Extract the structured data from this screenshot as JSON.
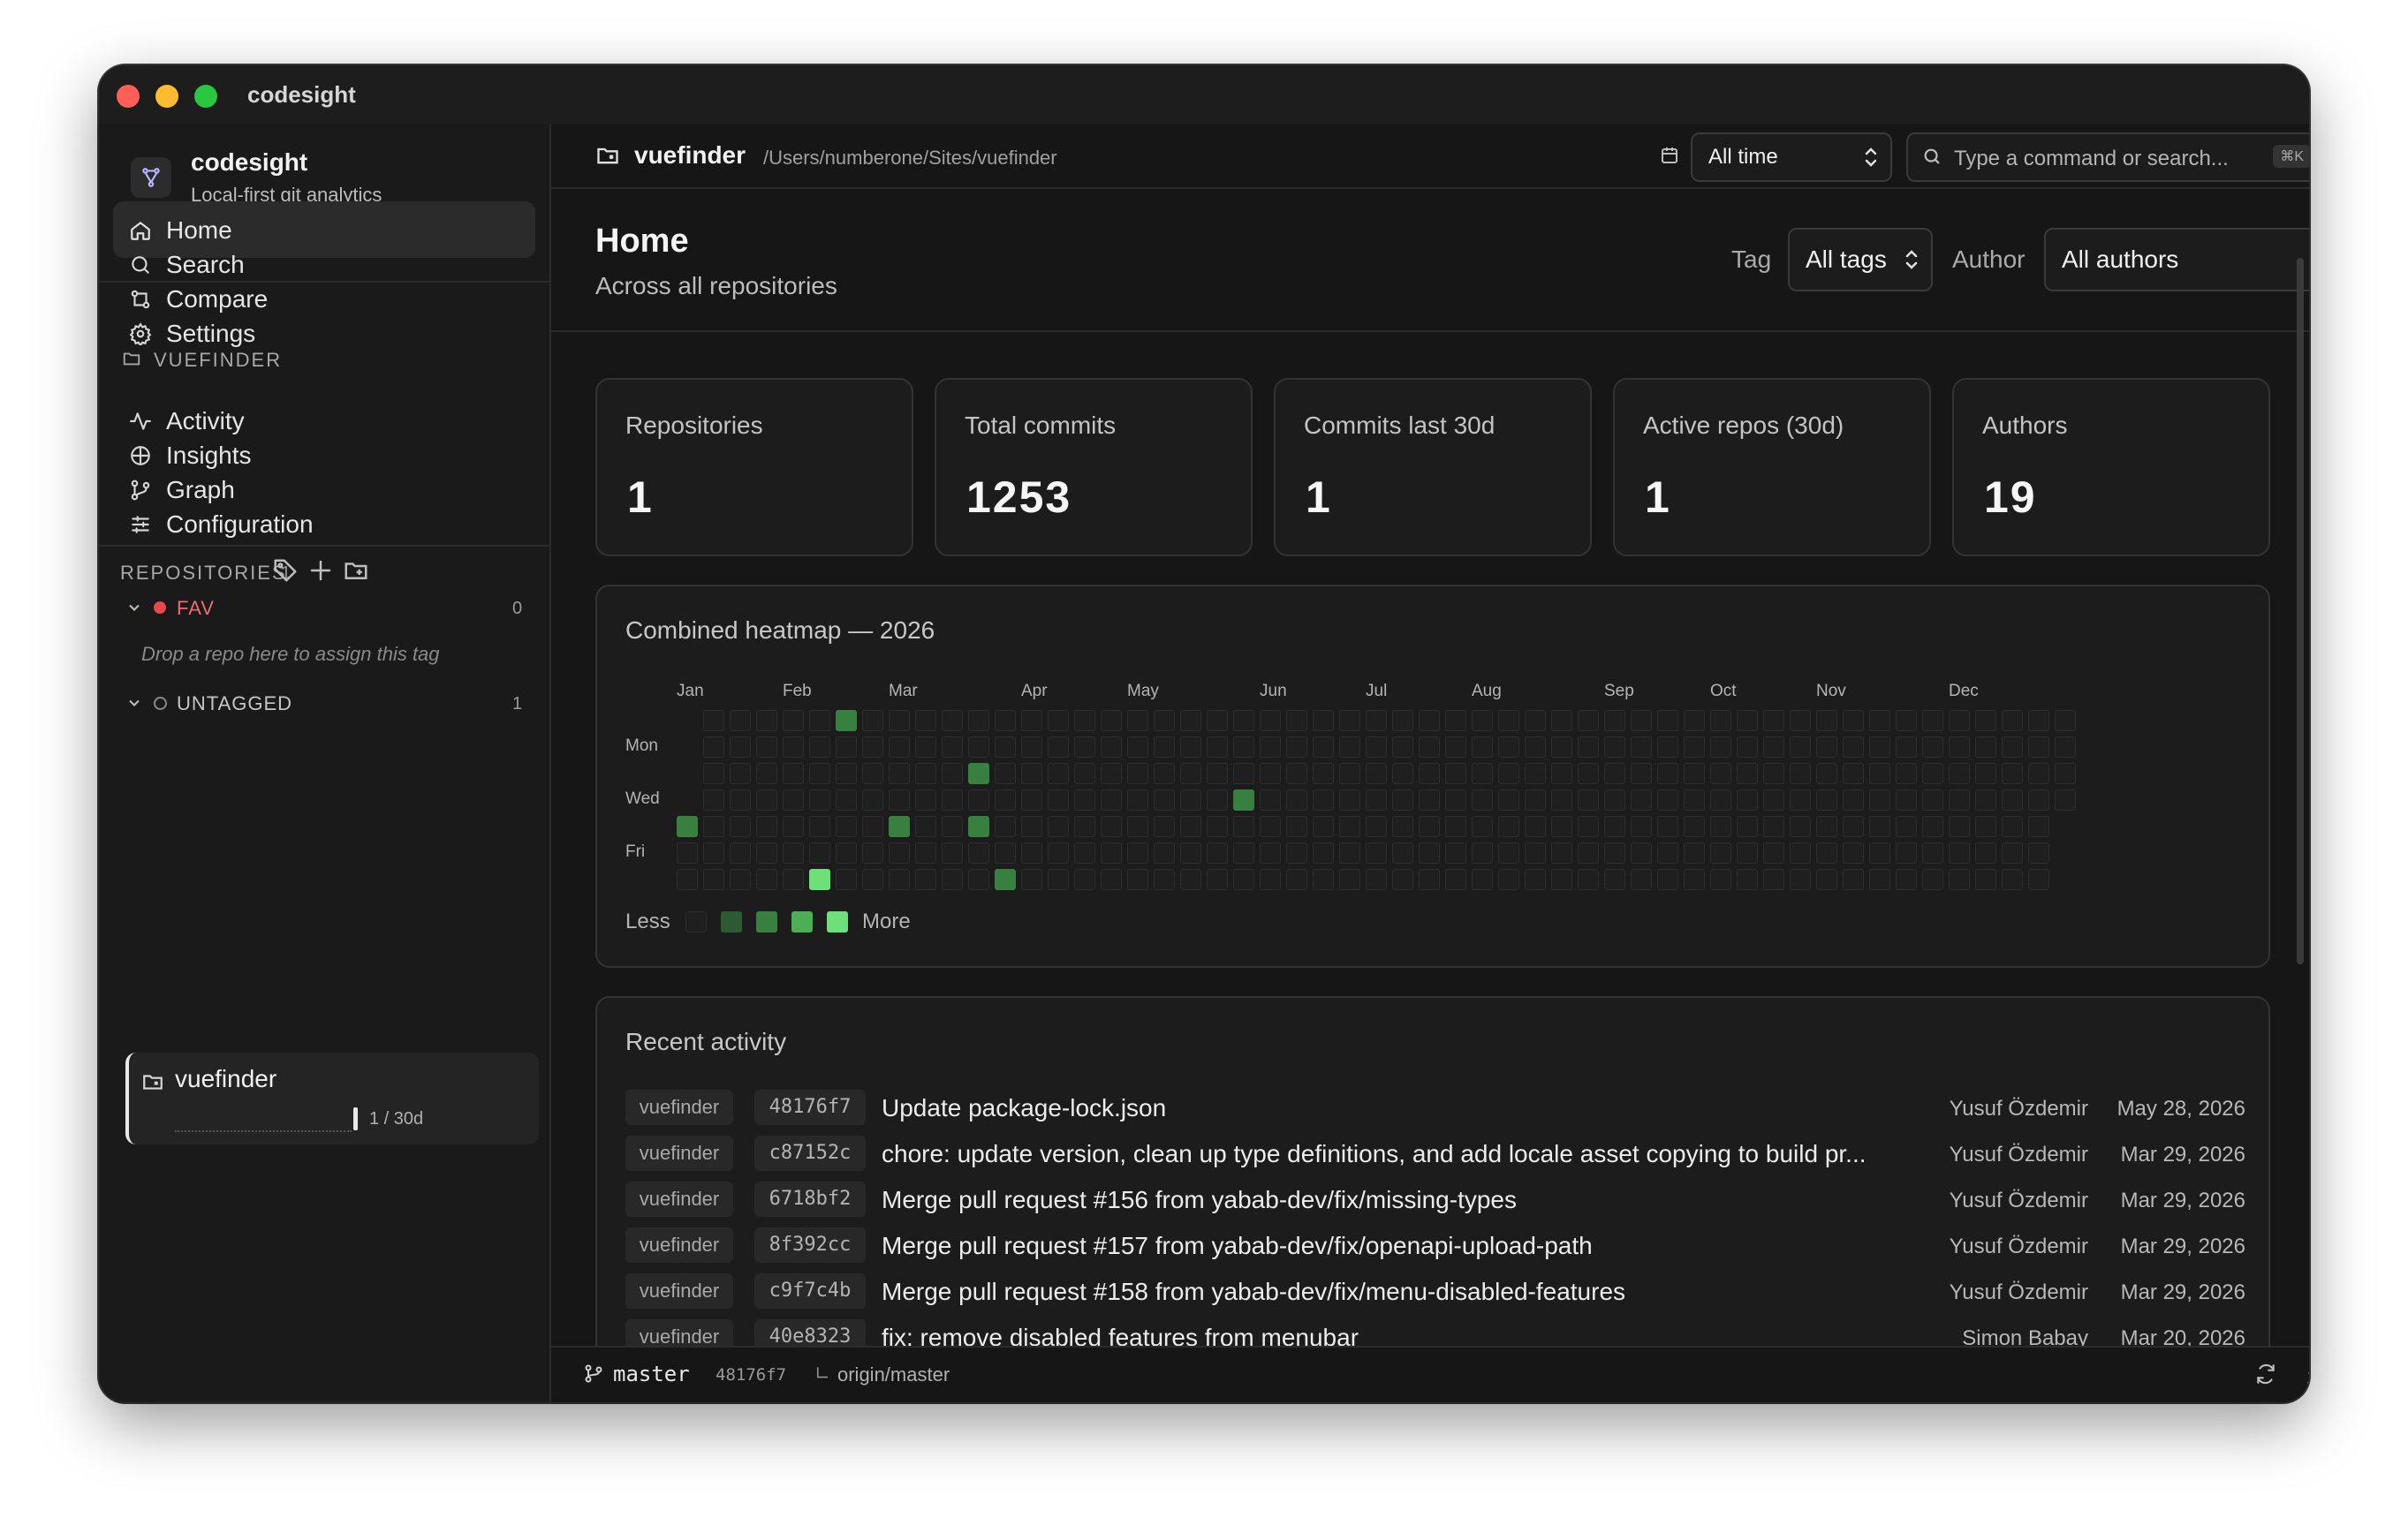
{
  "window": {
    "title": "codesight"
  },
  "sidebar": {
    "brand": {
      "name": "codesight",
      "tagline": "Local-first git analytics"
    },
    "nav": [
      {
        "label": "Home",
        "icon": "home-icon",
        "active": true
      },
      {
        "label": "Search",
        "icon": "search-icon"
      },
      {
        "label": "Compare",
        "icon": "compare-icon"
      },
      {
        "label": "Settings",
        "icon": "gear-icon"
      }
    ],
    "repo_section": "VUEFINDER",
    "repo_nav": [
      {
        "label": "Activity",
        "icon": "activity-icon"
      },
      {
        "label": "Insights",
        "icon": "insights-icon"
      },
      {
        "label": "Graph",
        "icon": "graph-icon"
      },
      {
        "label": "Configuration",
        "icon": "sliders-icon"
      }
    ],
    "repositories": {
      "label": "REPOSITORIES",
      "count": "1",
      "groups": [
        {
          "name": "FAV",
          "count": "0",
          "color": "#e5484d",
          "empty_hint": "Drop a repo here to assign this tag"
        },
        {
          "name": "UNTAGGED",
          "count": "1"
        }
      ],
      "repo": {
        "name": "vuefinder",
        "activity": "1 / 30d"
      }
    }
  },
  "topbar": {
    "repo_name": "vuefinder",
    "repo_path": "/Users/numberone/Sites/vuefinder",
    "time_range": "All time",
    "search_placeholder": "Type a command or search...",
    "search_shortcut": "⌘K"
  },
  "header": {
    "title": "Home",
    "subtitle": "Across all repositories",
    "tag_label": "Tag",
    "tag_value": "All tags",
    "author_label": "Author",
    "author_value": "All authors"
  },
  "stats": [
    {
      "label": "Repositories",
      "value": "1"
    },
    {
      "label": "Total commits",
      "value": "1253"
    },
    {
      "label": "Commits last 30d",
      "value": "1"
    },
    {
      "label": "Active repos (30d)",
      "value": "1"
    },
    {
      "label": "Authors",
      "value": "19"
    }
  ],
  "heatmap": {
    "title": "Combined heatmap — 2026",
    "months": [
      "Jan",
      "Feb",
      "Mar",
      "Apr",
      "May",
      "Jun",
      "Jul",
      "Aug",
      "Sep",
      "Oct",
      "Nov",
      "Dec"
    ],
    "days": [
      "Mon",
      "Wed",
      "Fri"
    ],
    "legend_less": "Less",
    "legend_more": "More",
    "levels": [
      "#1f2a1f",
      "#2b5a33",
      "#38803f",
      "#4caf55",
      "#6ee07a"
    ],
    "cells": [
      {
        "week": 6,
        "day": 0,
        "level": 2
      },
      {
        "week": 11,
        "day": 2,
        "level": 2
      },
      {
        "week": 21,
        "day": 3,
        "level": 2
      },
      {
        "week": 0,
        "day": 4,
        "level": 2
      },
      {
        "week": 8,
        "day": 4,
        "level": 2
      },
      {
        "week": 11,
        "day": 4,
        "level": 2
      },
      {
        "week": 5,
        "day": 6,
        "level": 4
      },
      {
        "week": 12,
        "day": 6,
        "level": 2
      }
    ]
  },
  "activity": {
    "title": "Recent activity",
    "rows": [
      {
        "repo": "vuefinder",
        "hash": "48176f7",
        "message": "Update package-lock.json",
        "author": "Yusuf Özdemir",
        "date": "May 28, 2026"
      },
      {
        "repo": "vuefinder",
        "hash": "c87152c",
        "message": "chore: update version, clean up type definitions, and add locale asset copying to build pr...",
        "author": "Yusuf Özdemir",
        "date": "Mar 29, 2026"
      },
      {
        "repo": "vuefinder",
        "hash": "6718bf2",
        "message": "Merge pull request #156 from yabab-dev/fix/missing-types",
        "author": "Yusuf Özdemir",
        "date": "Mar 29, 2026"
      },
      {
        "repo": "vuefinder",
        "hash": "8f392cc",
        "message": "Merge pull request #157 from yabab-dev/fix/openapi-upload-path",
        "author": "Yusuf Özdemir",
        "date": "Mar 29, 2026"
      },
      {
        "repo": "vuefinder",
        "hash": "c9f7c4b",
        "message": "Merge pull request #158 from yabab-dev/fix/menu-disabled-features",
        "author": "Yusuf Özdemir",
        "date": "Mar 29, 2026"
      },
      {
        "repo": "vuefinder",
        "hash": "40e8323",
        "message": "fix: remove disabled features from menubar",
        "author": "Simon Babay",
        "date": "Mar 20, 2026"
      }
    ]
  },
  "statusbar": {
    "branch": "master",
    "commit": "48176f7",
    "upstream": "origin/master"
  }
}
